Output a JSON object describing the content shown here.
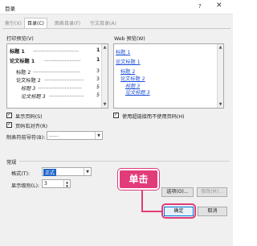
{
  "window": {
    "title": "目录",
    "help": "?",
    "close": "✕"
  },
  "tabs": [
    {
      "label": "索引(X)",
      "active": false
    },
    {
      "label": "目录(C)",
      "active": true
    },
    {
      "label": "图表目录(F)",
      "active": false
    },
    {
      "label": "引文目录(A)",
      "active": false
    }
  ],
  "print_preview": {
    "label": "打印预览(V)",
    "lines": [
      {
        "text": "标题 1",
        "page": "1"
      },
      {
        "text": "论文标题 1",
        "page": "1"
      },
      {
        "text": "标题 2",
        "page": "3"
      },
      {
        "text": "论文标题 2",
        "page": "3"
      },
      {
        "text": "标题 3",
        "page": "5"
      },
      {
        "text": "论文标题 3",
        "page": "5"
      }
    ]
  },
  "web_preview": {
    "label": "Web 预览(W)",
    "lines": [
      "标题 1",
      "论文标题 1",
      "标题 2",
      "论文标题 2",
      "标题 3",
      "论文标题 3"
    ]
  },
  "options": {
    "show_page_numbers": "显示页码(S)",
    "right_align": "页码右对齐(R)",
    "tab_leader_label": "制表符前导符(B):",
    "tab_leader_value": "......",
    "use_hyperlinks": "使用超链接而不使用页码(H)"
  },
  "general": {
    "label": "常规",
    "format_label": "格式(T):",
    "format_value": "正式",
    "levels_label": "显示级别(L):",
    "levels_value": "3"
  },
  "buttons": {
    "options": "选项(O)...",
    "modify": "修改(M)...",
    "ok": "确定",
    "cancel": "取消"
  },
  "annotation": {
    "callout": "单击",
    "color": "#e23b7a"
  },
  "icons": {
    "scroll_up": "▲",
    "scroll_down": "▼",
    "dropdown": "▼",
    "spin_up": "▲",
    "spin_down": "▼",
    "check": "✓"
  }
}
